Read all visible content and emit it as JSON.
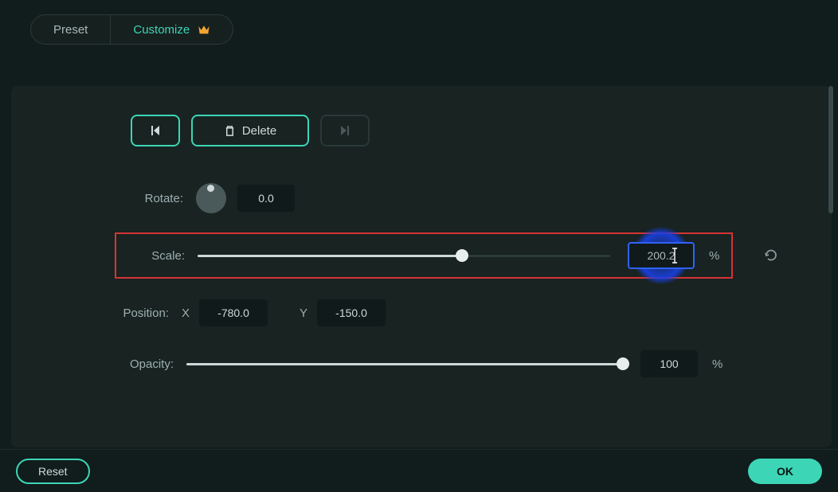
{
  "tabs": {
    "preset": "Preset",
    "customize": "Customize"
  },
  "buttons": {
    "delete": "Delete",
    "reset": "Reset",
    "ok": "OK"
  },
  "controls": {
    "rotate": {
      "label": "Rotate:",
      "value": "0.0"
    },
    "scale": {
      "label": "Scale:",
      "value": "200.2",
      "unit": "%",
      "fill_pct": 64
    },
    "position": {
      "label": "Position:",
      "x_label": "X",
      "x_value": "-780.0",
      "y_label": "Y",
      "y_value": "-150.0"
    },
    "opacity": {
      "label": "Opacity:",
      "value": "100",
      "unit": "%",
      "fill_pct": 100
    }
  }
}
